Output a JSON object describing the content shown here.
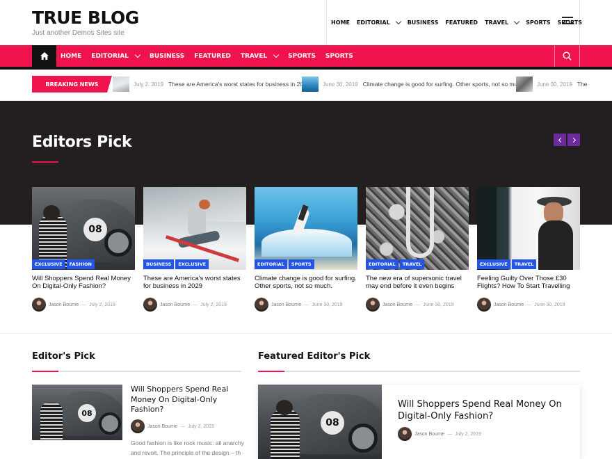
{
  "site": {
    "title": "TRUE BLOG",
    "tagline": "Just another Demos Sites site"
  },
  "top_nav": [
    {
      "label": "HOME",
      "dropdown": false
    },
    {
      "label": "EDITORIAL",
      "dropdown": true
    },
    {
      "label": "BUSINESS",
      "dropdown": false
    },
    {
      "label": "FEATURED",
      "dropdown": false
    },
    {
      "label": "TRAVEL",
      "dropdown": true
    },
    {
      "label": "SPORTS",
      "dropdown": false
    },
    {
      "label": "SPORTS",
      "dropdown": false
    }
  ],
  "main_nav": [
    {
      "label": "HOME",
      "dropdown": false
    },
    {
      "label": "EDITORIAL",
      "dropdown": true
    },
    {
      "label": "BUSINESS",
      "dropdown": false
    },
    {
      "label": "FEATURED",
      "dropdown": false
    },
    {
      "label": "TRAVEL",
      "dropdown": true
    },
    {
      "label": "SPORTS",
      "dropdown": false
    },
    {
      "label": "SPORTS",
      "dropdown": false
    }
  ],
  "breaking": {
    "label": "BREAKING NEWS",
    "items": [
      {
        "date": "July 2, 2019",
        "title": "These are America's worst states for business in 2029"
      },
      {
        "date": "June 30, 2019",
        "title": "Climate change is good for surfing. Other sports, not so much."
      },
      {
        "date": "June 30, 2019",
        "title": "The"
      }
    ]
  },
  "editors_pick": {
    "title": "Editors Pick",
    "cards": [
      {
        "tags": [
          "EXCLUSIVE",
          "FASHION"
        ],
        "title": "Will Shoppers Spend Real Money On Digital-Only Fashion?",
        "author": "Jason Bourne",
        "date": "July 2, 2019"
      },
      {
        "tags": [
          "BUSINESS",
          "EXCLUSIVE"
        ],
        "title": "These are America's worst states for business in 2029",
        "author": "Jason Bourne",
        "date": "July 2, 2019"
      },
      {
        "tags": [
          "EDITORIAL",
          "SPORTS"
        ],
        "title": "Climate change is good for surfing. Other sports, not so much.",
        "author": "Jason Bourne",
        "date": "June 30, 2019"
      },
      {
        "tags": [
          "EDITORIAL",
          "TRAVEL"
        ],
        "title": "The new era of supersonic travel may end before it even begins",
        "author": "Jason Bourne",
        "date": "June 30, 2019"
      },
      {
        "tags": [
          "EXCLUSIVE",
          "TRAVEL"
        ],
        "title": "Feeling Guilty Over Those £30 Flights? How To Start Travelling",
        "author": "Jason Bourne",
        "date": "June 30, 2019"
      }
    ]
  },
  "left_section": {
    "title": "Editor's Pick",
    "post": {
      "title": "Will Shoppers Spend Real Money On Digital-Only Fashion?",
      "author": "Jason Bourne",
      "date": "July 2, 2019",
      "excerpt": "Good fashion is like rock music: all anarchy and revolt. The principle of the design – th"
    }
  },
  "right_section": {
    "title": "Featured Editor's Pick",
    "post": {
      "title": "Will Shoppers Spend Real Money On Digital-Only Fashion?",
      "author": "Jason Bourne",
      "date": "July 2, 2019"
    }
  },
  "colors": {
    "accent": "#f0134d",
    "tag": "#2455e6",
    "arrow": "#6d2c9e",
    "dark": "#231f20"
  },
  "icons": {
    "home": "home-icon",
    "search": "search-icon",
    "menu": "hamburger-menu-icon",
    "prev": "chevron-left-icon",
    "next": "chevron-right-icon"
  },
  "dash": "—"
}
